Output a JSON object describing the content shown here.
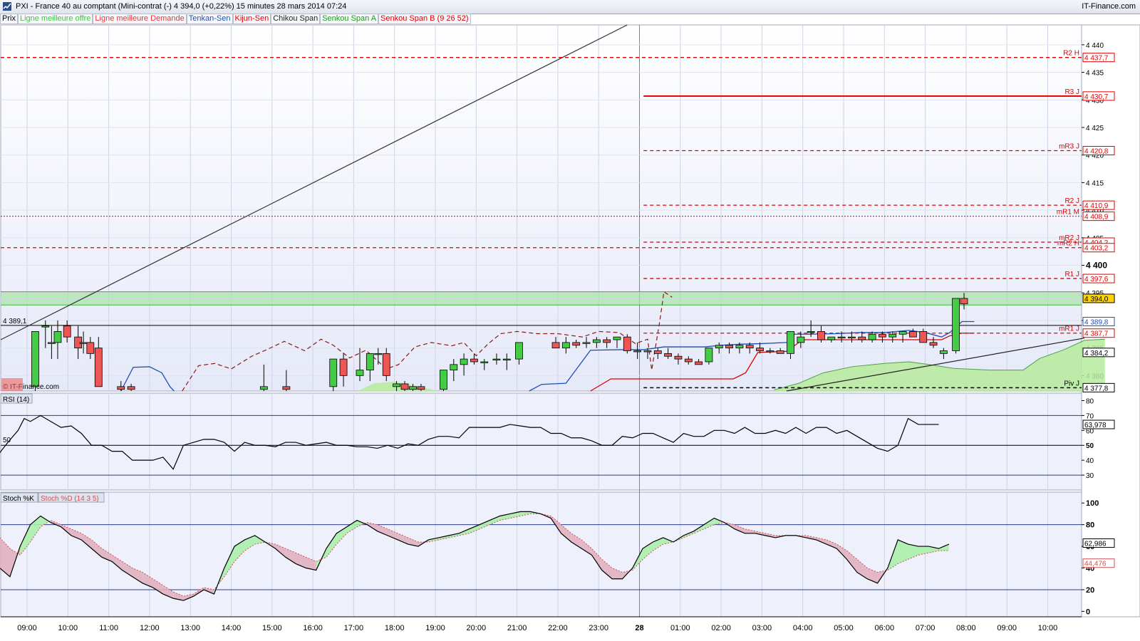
{
  "window": {
    "title": "PXI - France 40 au comptant (Mini-contrat  (-)   4 394,0 (+0,22%)   15 minutes  28 mars 2014 07:24",
    "brand": "IT-Finance.com",
    "copyright": "© IT-Finance.com"
  },
  "legend": [
    {
      "label": "Prix",
      "color": "#000000"
    },
    {
      "label": "Ligne meilleure offre",
      "color": "#33cc33"
    },
    {
      "label": "Ligne meilleure Demande",
      "color": "#ee3333"
    },
    {
      "label": "Tenkan-Sen",
      "color": "#1c4fb8"
    },
    {
      "label": "Kijun-Sen",
      "color": "#dd0000"
    },
    {
      "label": "Chikou Span",
      "color": "#222222"
    },
    {
      "label": "Senkou Span A",
      "color": "#1a9a1a"
    },
    {
      "label": "Senkou Span B (9 26 52)",
      "color": "#dd0000"
    }
  ],
  "panel_labels": {
    "rsi": "RSI (14)",
    "stoch_k": "Stoch %K",
    "stoch_d": "Stoch %D (14 3 5)",
    "ref_price": "4 389,1",
    "ref_rsi": "50"
  },
  "colors": {
    "bull": "#44cc44",
    "bear": "#ee5555",
    "tenkan": "#1c4fb8",
    "kijun": "#dd0000",
    "chikou": "#8b1a1a",
    "pivot": "#dd0000",
    "cloud": "#b6eb9c",
    "stoch_up": "#aaf0aa",
    "stoch_dn": "#e0b0c0",
    "panel_bg": "#eef0fb"
  },
  "chart_data": [
    {
      "type": "candlestick",
      "title": "PXI - France 40 au comptant (Mini-contrat  (-)",
      "interval": "15 minutes",
      "x_ticks": [
        "09:00",
        "10:00",
        "11:00",
        "12:00",
        "13:00",
        "14:00",
        "15:00",
        "16:00",
        "17:00",
        "18:00",
        "19:00",
        "20:00",
        "21:00",
        "22:00",
        "23:00",
        "28",
        "01:00",
        "02:00",
        "03:00",
        "04:00",
        "05:00",
        "06:00",
        "07:00",
        "08:00",
        "09:00",
        "10:00"
      ],
      "y_ticks": [
        4380,
        4385,
        4390,
        4395,
        4400,
        4405,
        4410,
        4415,
        4420,
        4425,
        4430,
        4435,
        4440
      ],
      "y_tick_labels": [
        "4 380",
        "4 385",
        "4 390",
        "4 395",
        "4 400",
        "4 405",
        "4 410",
        "4 415",
        "4 420",
        "4 425",
        "4 430",
        "4 435",
        "4 440"
      ],
      "ylim": [
        4377.2,
        4443.6
      ],
      "last_price": "4 394,0",
      "candles": [
        {
          "t": 0.2,
          "o": 4378,
          "h": 4388,
          "l": 4376,
          "c": 4388
        },
        {
          "t": 0.45,
          "o": 4389,
          "h": 4390,
          "l": 4385,
          "c": 4389
        },
        {
          "t": 0.6,
          "o": 4386,
          "h": 4389,
          "l": 4383,
          "c": 4386
        },
        {
          "t": 0.75,
          "o": 4386,
          "h": 4390,
          "l": 4383,
          "c": 4388
        },
        {
          "t": 0.98,
          "o": 4389,
          "h": 4390,
          "l": 4386,
          "c": 4387
        },
        {
          "t": 1.25,
          "o": 4387,
          "h": 4389,
          "l": 4383,
          "c": 4385
        },
        {
          "t": 1.38,
          "o": 4386,
          "h": 4388,
          "l": 4384,
          "c": 4386
        },
        {
          "t": 1.55,
          "o": 4386,
          "h": 4387,
          "l": 4383,
          "c": 4384
        },
        {
          "t": 1.75,
          "o": 4385,
          "h": 4387,
          "l": 4378,
          "c": 4378
        },
        {
          "t": 2.3,
          "o": 4378,
          "h": 4379,
          "l": 4377,
          "c": 4377.5
        },
        {
          "t": 2.55,
          "o": 4378,
          "h": 4378.5,
          "l": 4377,
          "c": 4377.5
        },
        {
          "t": 5.8,
          "o": 4377.5,
          "h": 4382,
          "l": 4377,
          "c": 4378
        },
        {
          "t": 6.35,
          "o": 4378,
          "h": 4381,
          "l": 4377,
          "c": 4377.5
        },
        {
          "t": 7.5,
          "o": 4378,
          "h": 4382,
          "l": 4376,
          "c": 4383
        },
        {
          "t": 7.75,
          "o": 4383,
          "h": 4384,
          "l": 4378,
          "c": 4380
        },
        {
          "t": 8.15,
          "o": 4380,
          "h": 4385,
          "l": 4379,
          "c": 4381
        },
        {
          "t": 8.4,
          "o": 4381,
          "h": 4383,
          "l": 4379,
          "c": 4384
        },
        {
          "t": 8.6,
          "o": 4384,
          "h": 4385,
          "l": 4382,
          "c": 4384
        },
        {
          "t": 8.8,
          "o": 4384,
          "h": 4385,
          "l": 4379,
          "c": 4380
        },
        {
          "t": 9.05,
          "o": 4378,
          "h": 4379,
          "l": 4377,
          "c": 4378.5
        },
        {
          "t": 9.25,
          "o": 4378.5,
          "h": 4379,
          "l": 4377,
          "c": 4377.5
        },
        {
          "t": 9.45,
          "o": 4377.5,
          "h": 4378.5,
          "l": 4377,
          "c": 4378
        },
        {
          "t": 9.65,
          "o": 4378,
          "h": 4378.5,
          "l": 4377,
          "c": 4377.5
        },
        {
          "t": 10.2,
          "o": 4377.5,
          "h": 4381,
          "l": 4377,
          "c": 4381
        },
        {
          "t": 10.45,
          "o": 4381,
          "h": 4383,
          "l": 4379,
          "c": 4382
        },
        {
          "t": 10.7,
          "o": 4382,
          "h": 4384,
          "l": 4380,
          "c": 4383
        },
        {
          "t": 10.95,
          "o": 4383,
          "h": 4384,
          "l": 4382,
          "c": 4382.5
        },
        {
          "t": 11.2,
          "o": 4382.5,
          "h": 4383,
          "l": 4381,
          "c": 4382.5
        },
        {
          "t": 11.5,
          "o": 4383,
          "h": 4384,
          "l": 4382,
          "c": 4383
        },
        {
          "t": 11.75,
          "o": 4383,
          "h": 4384,
          "l": 4381,
          "c": 4383
        },
        {
          "t": 12.05,
          "o": 4383,
          "h": 4386,
          "l": 4382,
          "c": 4386
        },
        {
          "t": 12.95,
          "o": 4386,
          "h": 4387,
          "l": 4385,
          "c": 4385
        },
        {
          "t": 13.2,
          "o": 4385,
          "h": 4387,
          "l": 4384,
          "c": 4386
        },
        {
          "t": 13.45,
          "o": 4386,
          "h": 4386.5,
          "l": 4385,
          "c": 4385.5
        },
        {
          "t": 13.7,
          "o": 4386,
          "h": 4387,
          "l": 4385,
          "c": 4386
        },
        {
          "t": 13.95,
          "o": 4386,
          "h": 4387,
          "l": 4385,
          "c": 4386.5
        },
        {
          "t": 14.2,
          "o": 4386.5,
          "h": 4387,
          "l": 4385,
          "c": 4386
        },
        {
          "t": 14.45,
          "o": 4386.5,
          "h": 4387,
          "l": 4385,
          "c": 4387
        },
        {
          "t": 14.7,
          "o": 4387,
          "h": 4387.5,
          "l": 4384,
          "c": 4384.5
        },
        {
          "t": 14.95,
          "o": 4384.5,
          "h": 4386,
          "l": 4383,
          "c": 4384.5
        },
        {
          "t": 15.2,
          "o": 4384.5,
          "h": 4385,
          "l": 4383,
          "c": 4384.5
        },
        {
          "t": 15.45,
          "o": 4384.5,
          "h": 4385,
          "l": 4383,
          "c": 4384
        },
        {
          "t": 15.7,
          "o": 4384,
          "h": 4385,
          "l": 4383,
          "c": 4383.5
        },
        {
          "t": 15.95,
          "o": 4383.5,
          "h": 4384,
          "l": 4382,
          "c": 4383
        },
        {
          "t": 16.2,
          "o": 4383,
          "h": 4383.5,
          "l": 4382,
          "c": 4382.5
        },
        {
          "t": 16.45,
          "o": 4382.5,
          "h": 4383,
          "l": 4382,
          "c": 4382
        },
        {
          "t": 16.7,
          "o": 4382.5,
          "h": 4385,
          "l": 4382,
          "c": 4385
        },
        {
          "t": 16.95,
          "o": 4385,
          "h": 4386,
          "l": 4384,
          "c": 4385.5
        },
        {
          "t": 17.2,
          "o": 4385.5,
          "h": 4386,
          "l": 4384,
          "c": 4385
        },
        {
          "t": 17.45,
          "o": 4385,
          "h": 4386,
          "l": 4384,
          "c": 4385.5
        },
        {
          "t": 17.7,
          "o": 4385.5,
          "h": 4386,
          "l": 4384,
          "c": 4385
        },
        {
          "t": 17.95,
          "o": 4385,
          "h": 4386,
          "l": 4384,
          "c": 4384.5
        },
        {
          "t": 18.2,
          "o": 4384.5,
          "h": 4385,
          "l": 4384,
          "c": 4384.5
        },
        {
          "t": 18.45,
          "o": 4384.5,
          "h": 4385,
          "l": 4384,
          "c": 4384
        },
        {
          "t": 18.7,
          "o": 4384,
          "h": 4388,
          "l": 4383,
          "c": 4388
        },
        {
          "t": 18.95,
          "o": 4386,
          "h": 4388,
          "l": 4385,
          "c": 4387
        },
        {
          "t": 19.2,
          "o": 4388,
          "h": 4390,
          "l": 4387,
          "c": 4388
        },
        {
          "t": 19.45,
          "o": 4388,
          "h": 4389,
          "l": 4386,
          "c": 4386.5
        },
        {
          "t": 19.7,
          "o": 4386.5,
          "h": 4387,
          "l": 4386,
          "c": 4387
        },
        {
          "t": 19.95,
          "o": 4387,
          "h": 4388,
          "l": 4386,
          "c": 4387
        },
        {
          "t": 20.2,
          "o": 4387,
          "h": 4388,
          "l": 4386,
          "c": 4387
        },
        {
          "t": 20.45,
          "o": 4387,
          "h": 4388,
          "l": 4386,
          "c": 4386.5
        },
        {
          "t": 20.7,
          "o": 4386.5,
          "h": 4388,
          "l": 4386,
          "c": 4387.5
        },
        {
          "t": 20.95,
          "o": 4387.5,
          "h": 4388,
          "l": 4386,
          "c": 4387
        },
        {
          "t": 21.2,
          "o": 4387,
          "h": 4388,
          "l": 4386,
          "c": 4387.5
        },
        {
          "t": 21.45,
          "o": 4387.5,
          "h": 4388,
          "l": 4386,
          "c": 4388
        },
        {
          "t": 21.7,
          "o": 4388,
          "h": 4388.5,
          "l": 4387,
          "c": 4387
        },
        {
          "t": 21.95,
          "o": 4388,
          "h": 4388.5,
          "l": 4386,
          "c": 4386
        },
        {
          "t": 22.2,
          "o": 4386,
          "h": 4387,
          "l": 4385,
          "c": 4385.5
        },
        {
          "t": 22.45,
          "o": 4384,
          "h": 4385,
          "l": 4383,
          "c": 4384.5
        },
        {
          "t": 22.75,
          "o": 4384.5,
          "h": 4394,
          "l": 4384,
          "c": 4394
        },
        {
          "t": 22.95,
          "o": 4394,
          "h": 4395,
          "l": 4392,
          "c": 4393
        }
      ]
    },
    {
      "type": "line",
      "title": "RSI (14)",
      "y_ticks": [
        30,
        40,
        50,
        60,
        70,
        80
      ],
      "ylim": [
        20,
        85
      ],
      "reference_lines": [
        70,
        50,
        30
      ],
      "last_value": "63,978",
      "x": [
        0,
        0.2,
        0.45,
        0.6,
        0.75,
        1.0,
        1.25,
        1.5,
        1.75,
        2.0,
        2.25,
        2.5,
        2.75,
        3.0,
        3.25,
        3.5,
        3.75,
        4.0,
        4.25,
        4.5,
        4.75,
        5.0,
        5.25,
        5.5,
        5.75,
        6.0,
        6.25,
        6.5,
        6.75,
        7.0,
        7.25,
        7.5,
        7.75,
        8.0,
        8.25,
        8.5,
        8.75,
        9.0,
        9.25,
        9.5,
        9.75,
        10.0,
        10.25,
        10.5,
        10.75,
        11.0,
        11.25,
        11.5,
        11.75,
        12.0,
        12.25,
        12.5,
        12.75,
        13.0,
        13.25,
        13.5,
        13.75,
        14.0,
        14.25,
        14.5,
        14.75,
        15.0,
        15.25,
        15.5,
        15.75,
        16.0,
        16.25,
        16.5,
        16.75,
        17.0,
        17.25,
        17.5,
        17.75,
        18.0,
        18.25,
        18.5,
        18.75,
        19.0,
        19.25,
        19.5,
        19.75,
        20.0,
        20.25,
        20.5,
        20.75,
        21.0,
        21.25,
        21.5,
        21.75,
        22.0,
        22.25,
        22.5,
        22.75,
        23.0
      ],
      "values": [
        45,
        52,
        60,
        68,
        66,
        70,
        66,
        62,
        63,
        58,
        50,
        50,
        46,
        46,
        40,
        40,
        40,
        42,
        34,
        50,
        52,
        54,
        54,
        52,
        46,
        52,
        50,
        50,
        49,
        52,
        52,
        50,
        51,
        52,
        50,
        50,
        49,
        49,
        48,
        50,
        48,
        51,
        50,
        54,
        56,
        56,
        55,
        62,
        62,
        62,
        62,
        64,
        63,
        62,
        62,
        58,
        58,
        55,
        55,
        53,
        50,
        50,
        56,
        55,
        58,
        58,
        55,
        52,
        58,
        56,
        56,
        60,
        60,
        58,
        62,
        58,
        58,
        60,
        58,
        62,
        58,
        62,
        62,
        58,
        60,
        56,
        52,
        48,
        46,
        50,
        68,
        64,
        64,
        64
      ]
    },
    {
      "type": "line",
      "title": "Stoch %K / Stoch %D (14 3 5)",
      "y_ticks": [
        0,
        20,
        40,
        60,
        80,
        100
      ],
      "ylim": [
        -5,
        110
      ],
      "reference_lines": [
        80,
        20
      ],
      "last_values": {
        "k": "62,986",
        "d": "44,476"
      },
      "series": [
        {
          "name": "Stoch %K",
          "values": [
            40,
            32,
            60,
            80,
            88,
            82,
            78,
            70,
            66,
            58,
            50,
            46,
            38,
            32,
            26,
            22,
            16,
            12,
            10,
            14,
            20,
            16,
            40,
            60,
            66,
            70,
            64,
            58,
            50,
            44,
            40,
            38,
            58,
            72,
            78,
            84,
            80,
            74,
            70,
            66,
            62,
            60,
            66,
            68,
            70,
            72,
            76,
            80,
            84,
            88,
            90,
            92,
            92,
            90,
            86,
            72,
            64,
            58,
            52,
            38,
            30,
            30,
            40,
            58,
            64,
            68,
            64,
            70,
            74,
            80,
            86,
            82,
            76,
            72,
            72,
            70,
            68,
            70,
            70,
            68,
            66,
            62,
            58,
            48,
            36,
            30,
            26,
            40,
            66,
            62,
            60,
            60,
            58,
            62
          ]
        },
        {
          "name": "Stoch %D (14 3 5)",
          "values": [
            68,
            58,
            52,
            64,
            78,
            84,
            80,
            76,
            72,
            66,
            58,
            52,
            46,
            40,
            36,
            30,
            24,
            18,
            14,
            16,
            22,
            20,
            32,
            46,
            56,
            62,
            64,
            62,
            58,
            54,
            50,
            46,
            50,
            62,
            72,
            78,
            82,
            80,
            76,
            72,
            68,
            64,
            64,
            66,
            68,
            70,
            72,
            76,
            80,
            84,
            86,
            88,
            90,
            90,
            88,
            80,
            72,
            66,
            58,
            48,
            40,
            36,
            38,
            48,
            56,
            62,
            64,
            68,
            72,
            76,
            80,
            82,
            80,
            76,
            74,
            72,
            70,
            70,
            70,
            70,
            68,
            66,
            62,
            56,
            48,
            40,
            36,
            38,
            44,
            48,
            52,
            54,
            56,
            56
          ]
        }
      ]
    }
  ],
  "pivots": [
    {
      "label": "R2 H",
      "value": 4437.7,
      "value_label": "4 437,7",
      "style": "dashed",
      "full": true
    },
    {
      "label": "R3 J",
      "value": 4430.7,
      "value_label": "4 430,7",
      "style": "solid",
      "full": false
    },
    {
      "label": "mR3 J",
      "value": 4420.8,
      "value_label": "4 420,8",
      "style": "dashed",
      "full": false
    },
    {
      "label": "R2 J",
      "value": 4410.9,
      "value_label": "4 410,9",
      "style": "dashed",
      "full": false
    },
    {
      "label": "mR1 M",
      "value": 4408.9,
      "value_label": "4 408,9",
      "style": "dotted",
      "full": true
    },
    {
      "label": "mR2 J",
      "value": 4404.2,
      "value_label": "4 404,2",
      "style": "dashed",
      "full": false
    },
    {
      "label": "mR2 H",
      "value": 4403.2,
      "value_label": "4 403,2",
      "style": "dashed",
      "full": true
    },
    {
      "label": "R1 J",
      "value": 4397.6,
      "value_label": "4 397,6",
      "style": "dashed",
      "full": false
    },
    {
      "label": "mR1 J",
      "value": 4387.7,
      "value_label": "4 387,7",
      "style": "dashed",
      "full": false
    },
    {
      "label": "Piv J",
      "value": 4377.8,
      "value_label": "4 377,8",
      "style": "blackdash",
      "full": false
    }
  ],
  "side_values": [
    {
      "value": 4394.0,
      "label": "4 394,0",
      "kind": "last"
    },
    {
      "value": 4389.8,
      "label": "4 389,8",
      "kind": "tenkan"
    },
    {
      "value": 4384.2,
      "label": "4 384,2",
      "kind": "plain"
    }
  ]
}
